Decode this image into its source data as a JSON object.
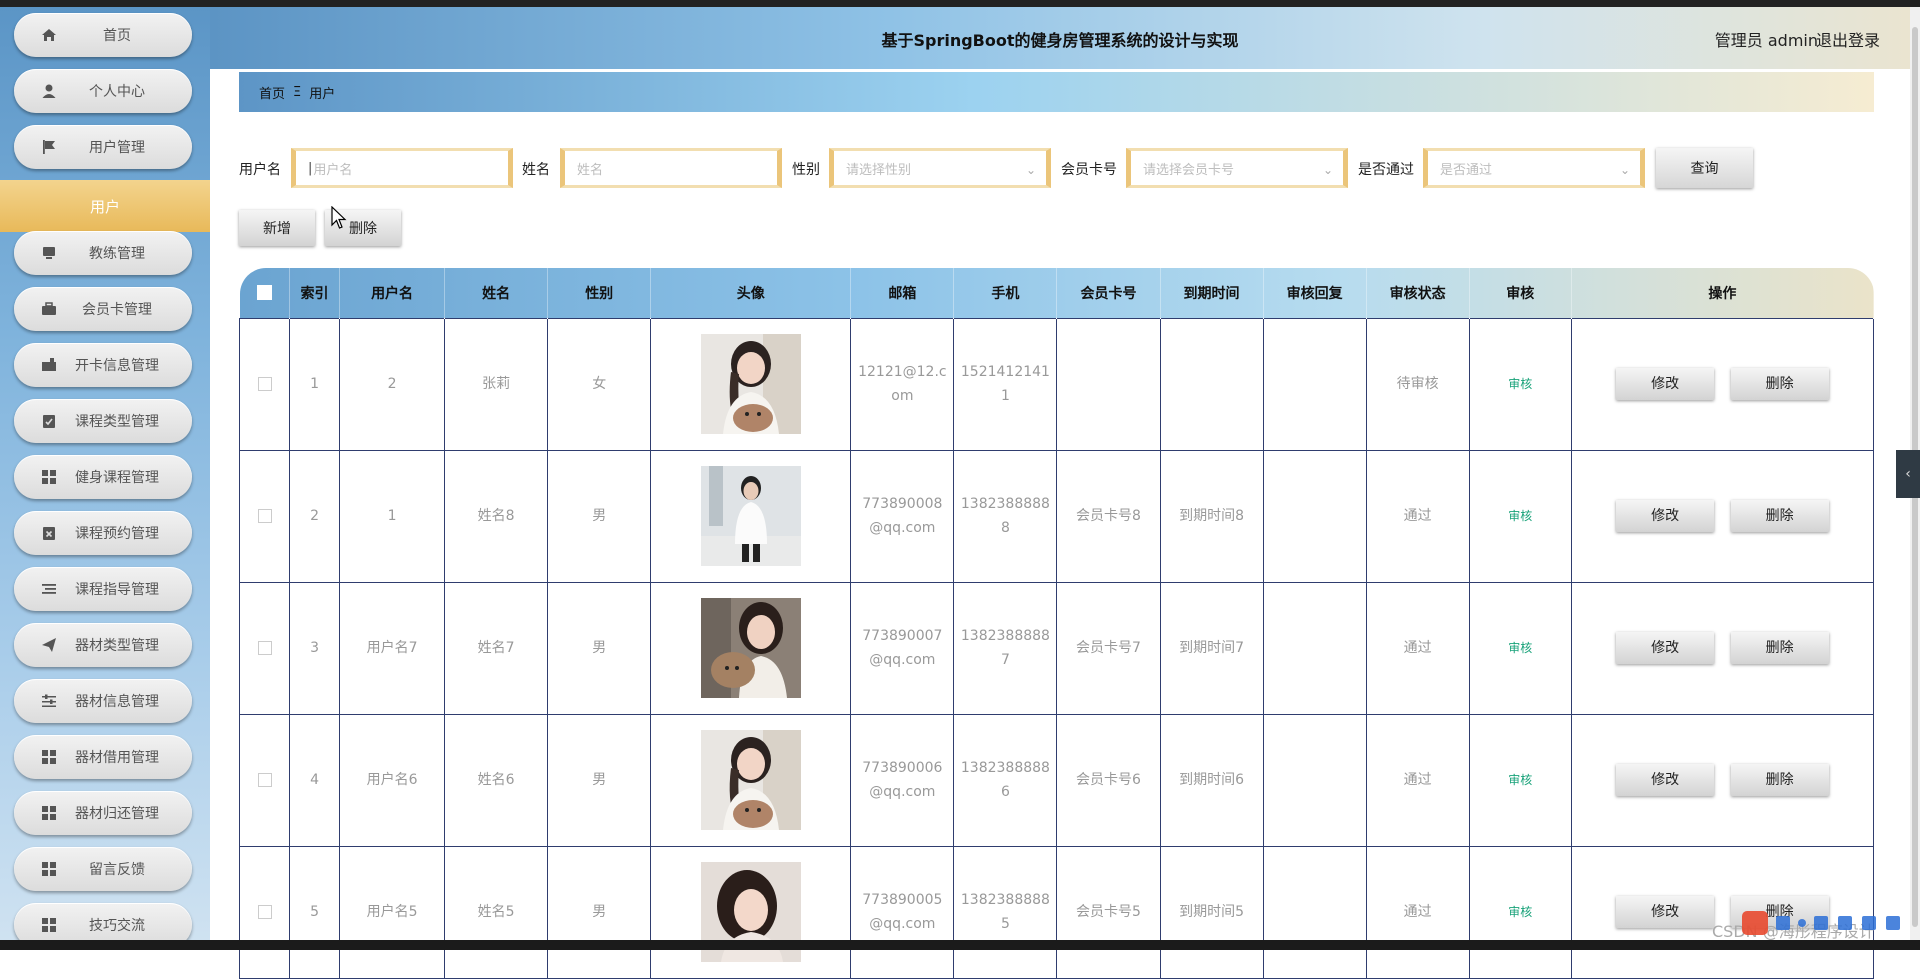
{
  "app": {
    "title": "基于SpringBoot的健身房管理系统的设计与实现",
    "admin": "管理员 admin",
    "logout": "退出登录"
  },
  "sidebar": {
    "items": [
      {
        "label": "首页",
        "icon": "home-icon"
      },
      {
        "label": "个人中心",
        "icon": "user-icon"
      },
      {
        "label": "用户管理",
        "icon": "flag-icon"
      },
      {
        "label": "教练管理",
        "icon": "monitor-icon"
      },
      {
        "label": "会员卡管理",
        "icon": "briefcase-icon"
      },
      {
        "label": "开卡信息管理",
        "icon": "card-icon"
      },
      {
        "label": "课程类型管理",
        "icon": "clipboard-check-icon"
      },
      {
        "label": "健身课程管理",
        "icon": "grid-icon"
      },
      {
        "label": "课程预约管理",
        "icon": "clipboard-x-icon"
      },
      {
        "label": "课程指导管理",
        "icon": "list-icon"
      },
      {
        "label": "器材类型管理",
        "icon": "send-icon"
      },
      {
        "label": "器材信息管理",
        "icon": "sliders-icon"
      },
      {
        "label": "器材借用管理",
        "icon": "grid-icon"
      },
      {
        "label": "器材归还管理",
        "icon": "grid-icon"
      },
      {
        "label": "留言反馈",
        "icon": "grid-icon"
      },
      {
        "label": "技巧交流",
        "icon": "grid-icon"
      }
    ],
    "active_sub": "用户"
  },
  "breadcrumb": {
    "home": "首页",
    "sep": "Ξ",
    "current": "用户"
  },
  "search": {
    "username_label": "用户名",
    "username_placeholder": "用户名",
    "name_label": "姓名",
    "name_placeholder": "姓名",
    "gender_label": "性别",
    "gender_placeholder": "请选择性别",
    "card_label": "会员卡号",
    "card_placeholder": "请选择会员卡号",
    "pass_label": "是否通过",
    "pass_placeholder": "是否通过",
    "query_label": "查询"
  },
  "actions": {
    "add_label": "新增",
    "delete_label": "删除"
  },
  "table": {
    "headers": [
      "索引",
      "用户名",
      "姓名",
      "性别",
      "头像",
      "邮箱",
      "手机",
      "会员卡号",
      "到期时间",
      "审核回复",
      "审核状态",
      "审核",
      "操作"
    ],
    "audit_link": "审核",
    "edit_label": "修改",
    "delete_label": "删除",
    "rows": [
      {
        "index": "1",
        "username": "2",
        "name": "张莉",
        "gender": "女",
        "avatar": "photo-girl-with-dog",
        "email": "12121@12.com",
        "phone": "15214121411",
        "card": "",
        "expire": "",
        "reply": "",
        "status": "待审核"
      },
      {
        "index": "2",
        "username": "1",
        "name": "姓名8",
        "gender": "男",
        "avatar": "photo-boy-white-shirt",
        "email": "773890008@qq.com",
        "phone": "13823888888",
        "card": "会员卡号8",
        "expire": "到期时间8",
        "reply": "",
        "status": "通过"
      },
      {
        "index": "3",
        "username": "用户名7",
        "name": "姓名7",
        "gender": "男",
        "avatar": "photo-girl-with-puppy",
        "email": "773890007@qq.com",
        "phone": "13823888887",
        "card": "会员卡号7",
        "expire": "到期时间7",
        "reply": "",
        "status": "通过"
      },
      {
        "index": "4",
        "username": "用户名6",
        "name": "姓名6",
        "gender": "男",
        "avatar": "photo-girl-with-dog",
        "email": "773890006@qq.com",
        "phone": "13823888886",
        "card": "会员卡号6",
        "expire": "到期时间6",
        "reply": "",
        "status": "通过"
      },
      {
        "index": "5",
        "username": "用户名5",
        "name": "姓名5",
        "gender": "男",
        "avatar": "photo-girl-portrait",
        "email": "773890005@qq.com",
        "phone": "13823888885",
        "card": "会员卡号5",
        "expire": "到期时间5",
        "reply": "",
        "status": "通过"
      }
    ]
  },
  "watermark": "CSDN @海彤程序设计",
  "colors": {
    "accent_gold": "#e8b95a",
    "header_blue": "#5c94c4",
    "audit_green": "#1aa37a",
    "table_border": "#2f3d6e"
  }
}
